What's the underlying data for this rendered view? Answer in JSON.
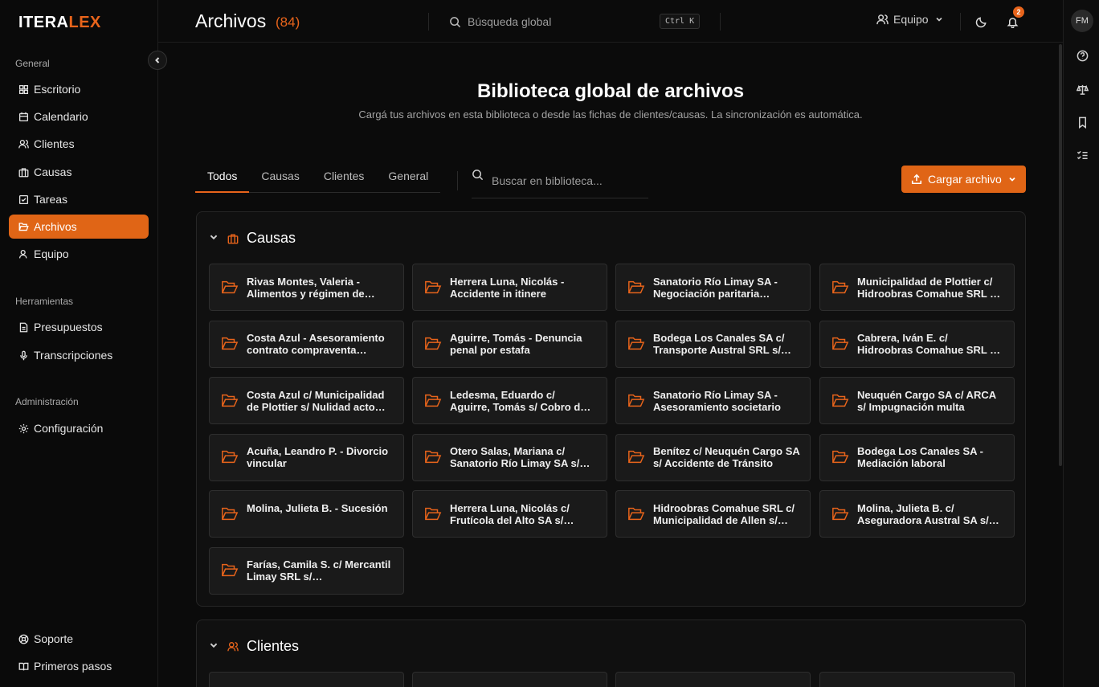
{
  "brand": {
    "logo_white": "ITERA",
    "logo_orange": "LEX"
  },
  "sidebar": {
    "sections": [
      {
        "label": "General"
      },
      {
        "label": "Herramientas"
      },
      {
        "label": "Administración"
      }
    ],
    "items": [
      {
        "label": "Escritorio",
        "icon": "grid-icon"
      },
      {
        "label": "Calendario",
        "icon": "calendar-icon"
      },
      {
        "label": "Clientes",
        "icon": "users-icon"
      },
      {
        "label": "Causas",
        "icon": "briefcase-icon"
      },
      {
        "label": "Tareas",
        "icon": "checkbox-icon"
      },
      {
        "label": "Archivos",
        "icon": "folder-icon",
        "active": true
      },
      {
        "label": "Equipo",
        "icon": "user-icon"
      },
      {
        "label": "Presupuestos",
        "icon": "document-icon"
      },
      {
        "label": "Transcripciones",
        "icon": "microphone-icon"
      },
      {
        "label": "Configuración",
        "icon": "gear-icon"
      },
      {
        "label": "Soporte",
        "icon": "lifebuoy-icon"
      },
      {
        "label": "Primeros pasos",
        "icon": "book-icon"
      }
    ]
  },
  "header": {
    "title": "Archivos",
    "count": "(84)",
    "search_placeholder": "Búsqueda global",
    "shortcut": "Ctrl K",
    "team_label": "Equipo",
    "notifications": "2",
    "avatar": "FM"
  },
  "library": {
    "title": "Biblioteca global de archivos",
    "subtitle": "Cargá tus archivos en esta biblioteca o desde las fichas de clientes/causas. La sincronización es automática.",
    "tabs": [
      "Todos",
      "Causas",
      "Clientes",
      "General"
    ],
    "search_placeholder": "Buscar en biblioteca...",
    "upload_label": "Cargar archivo"
  },
  "causas": {
    "title": "Causas",
    "folders": [
      "Rivas Montes, Valeria - Alimentos y régimen de…",
      "Herrera Luna, Nicolás - Accidente in itinere",
      "Sanatorio Río Limay SA - Negociación paritaria…",
      "Municipalidad de Plottier c/ Hidroobras Comahue SRL …",
      "Costa Azul - Asesoramiento contrato compraventa…",
      "Aguirre, Tomás - Denuncia penal por estafa",
      "Bodega Los Canales SA c/ Transporte Austral SRL s/…",
      "Cabrera, Iván E. c/ Hidroobras Comahue SRL …",
      "Costa Azul c/ Municipalidad de Plottier s/ Nulidad acto…",
      "Ledesma, Eduardo c/ Aguirre, Tomás s/ Cobro d…",
      "Sanatorio Río Limay SA - Asesoramiento societario",
      "Neuquén Cargo SA c/ ARCA s/ Impugnación multa",
      "Acuña, Leandro P. - Divorcio vincular",
      "Otero Salas, Mariana c/ Sanatorio Río Limay SA s/…",
      "Benítez c/ Neuquén Cargo SA s/ Accidente de Tránsito",
      "Bodega Los Canales SA - Mediación laboral",
      "Molina, Julieta B. - Sucesión",
      "Herrera Luna, Nicolás c/ Frutícola del Alto SA s/…",
      "Hidroobras Comahue SRL c/ Municipalidad de Allen s/…",
      "Molina, Julieta B. c/ Aseguradora Austral SA s/…",
      "Farías, Camila S. c/ Mercantil Limay SRL s/…"
    ]
  },
  "clientes": {
    "title": "Clientes"
  },
  "colors": {
    "accent": "#e8641b",
    "background": "#0b0b0b",
    "card": "#1a1a1a"
  }
}
